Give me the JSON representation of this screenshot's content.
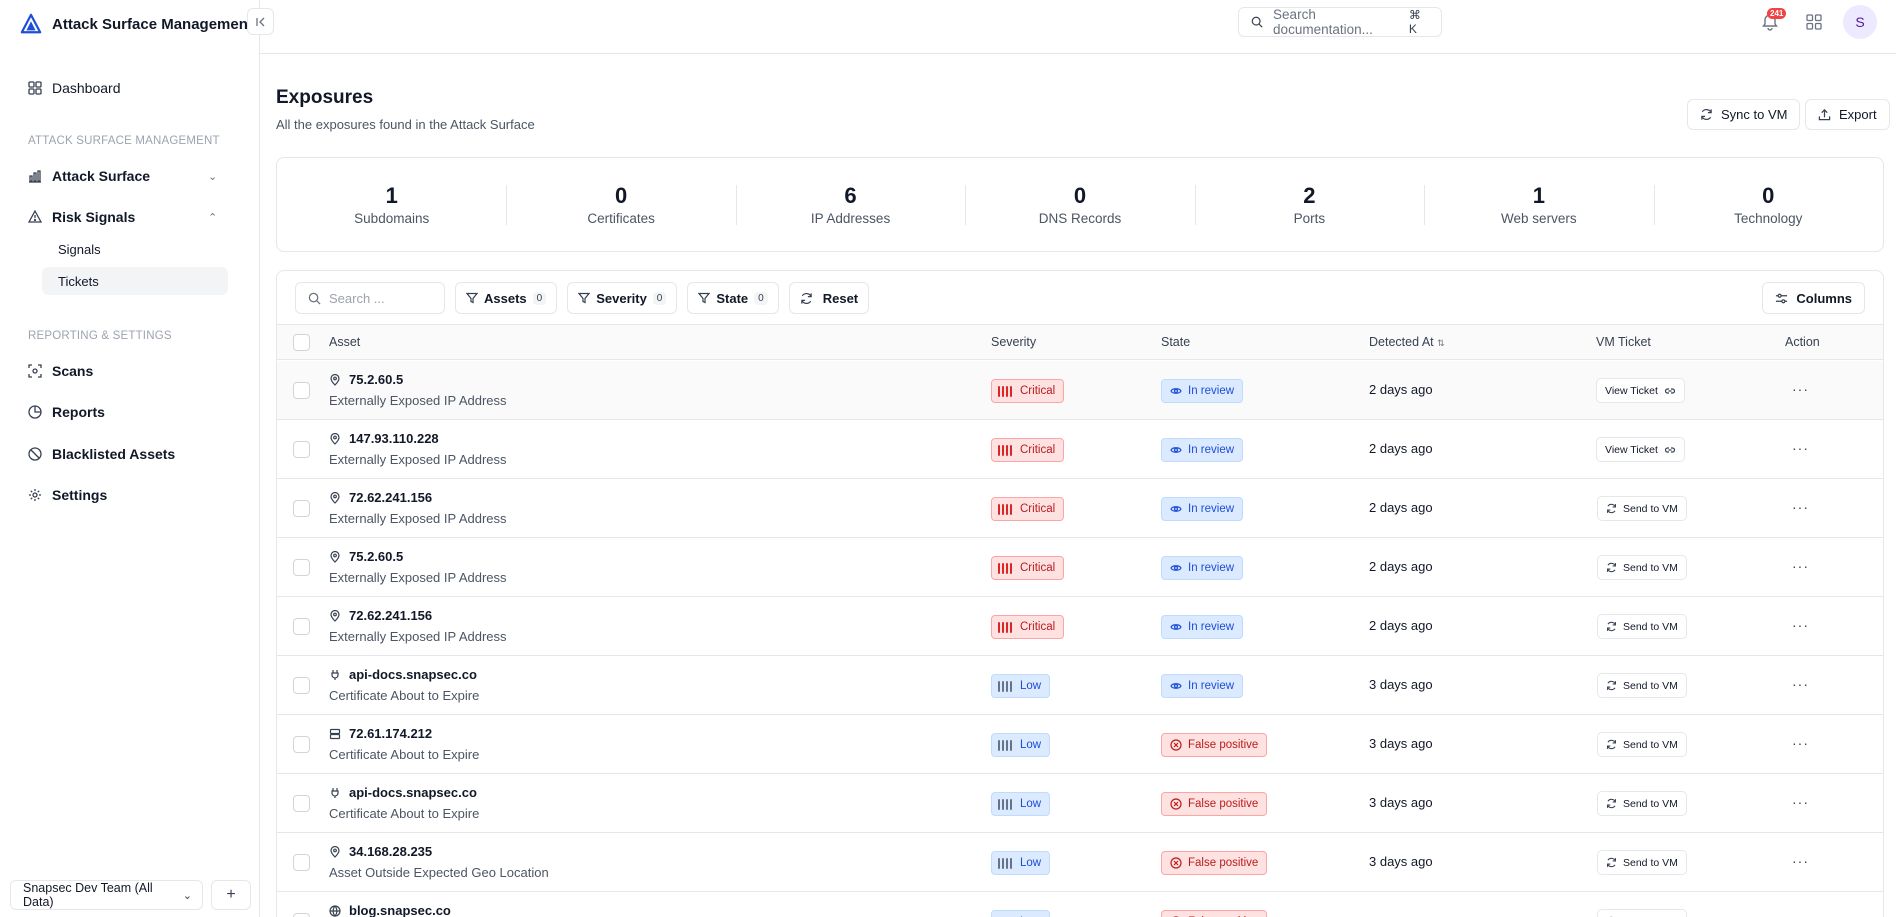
{
  "app": {
    "name": "Attack Surface Management"
  },
  "sidebar": {
    "dashboard": "Dashboard",
    "section_asm": "ATTACK SURFACE MANAGEMENT",
    "attack_surface": "Attack Surface",
    "risk_signals": "Risk Signals",
    "signals": "Signals",
    "tickets": "Tickets",
    "section_reporting": "REPORTING & SETTINGS",
    "scans": "Scans",
    "reports": "Reports",
    "blacklisted": "Blacklisted Assets",
    "settings": "Settings",
    "team": "Snapsec Dev Team (All Data)",
    "team_add": "+"
  },
  "topbar": {
    "search_placeholder": "Search documentation...",
    "search_kbd": "⌘ K",
    "notifications_count": "241",
    "avatar_initial": "S"
  },
  "header": {
    "title": "Exposures",
    "subtitle": "All the exposures found in the Attack Surface",
    "sync_label": "Sync to VM",
    "export_label": "Export"
  },
  "stats": [
    {
      "value": "1",
      "label": "Subdomains"
    },
    {
      "value": "0",
      "label": "Certificates"
    },
    {
      "value": "6",
      "label": "IP Addresses"
    },
    {
      "value": "0",
      "label": "DNS Records"
    },
    {
      "value": "2",
      "label": "Ports"
    },
    {
      "value": "1",
      "label": "Web servers"
    },
    {
      "value": "0",
      "label": "Technology"
    }
  ],
  "filters": {
    "search_placeholder": "Search ...",
    "assets": "Assets",
    "assets_count": "0",
    "severity": "Severity",
    "severity_count": "0",
    "state": "State",
    "state_count": "0",
    "reset": "Reset",
    "columns": "Columns"
  },
  "table": {
    "headers": {
      "asset": "Asset",
      "severity": "Severity",
      "state": "State",
      "detected": "Detected At",
      "vm_ticket": "VM Ticket",
      "action": "Action"
    },
    "rows": [
      {
        "name": "75.2.60.5",
        "icon": "location-icon",
        "desc": "Externally Exposed IP Address",
        "severity": "Critical",
        "state": "In review",
        "detected": "2 days ago",
        "vm": "View Ticket"
      },
      {
        "name": "147.93.110.228",
        "icon": "location-icon",
        "desc": "Externally Exposed IP Address",
        "severity": "Critical",
        "state": "In review",
        "detected": "2 days ago",
        "vm": "View Ticket"
      },
      {
        "name": "72.62.241.156",
        "icon": "location-icon",
        "desc": "Externally Exposed IP Address",
        "severity": "Critical",
        "state": "In review",
        "detected": "2 days ago",
        "vm": "Send to VM"
      },
      {
        "name": "75.2.60.5",
        "icon": "location-icon",
        "desc": "Externally Exposed IP Address",
        "severity": "Critical",
        "state": "In review",
        "detected": "2 days ago",
        "vm": "Send to VM"
      },
      {
        "name": "72.62.241.156",
        "icon": "location-icon",
        "desc": "Externally Exposed IP Address",
        "severity": "Critical",
        "state": "In review",
        "detected": "2 days ago",
        "vm": "Send to VM"
      },
      {
        "name": "api-docs.snapsec.co",
        "icon": "plug-icon",
        "desc": "Certificate About to Expire",
        "severity": "Low",
        "state": "In review",
        "detected": "3 days ago",
        "vm": "Send to VM"
      },
      {
        "name": "72.61.174.212",
        "icon": "server-icon",
        "desc": "Certificate About to Expire",
        "severity": "Low",
        "state": "False positive",
        "detected": "3 days ago",
        "vm": "Send to VM"
      },
      {
        "name": "api-docs.snapsec.co",
        "icon": "plug-icon",
        "desc": "Certificate About to Expire",
        "severity": "Low",
        "state": "False positive",
        "detected": "3 days ago",
        "vm": "Send to VM"
      },
      {
        "name": "34.168.28.235",
        "icon": "location-icon",
        "desc": "Asset Outside Expected Geo Location",
        "severity": "Low",
        "state": "False positive",
        "detected": "3 days ago",
        "vm": "Send to VM"
      },
      {
        "name": "blog.snapsec.co",
        "icon": "globe-icon",
        "desc": "",
        "severity": "Low",
        "state": "False positive",
        "detected": "",
        "vm": "Send to VM"
      }
    ]
  },
  "colors": {
    "accent": "#2563eb",
    "critical": "#dc2626",
    "low": "#1d4ed8"
  }
}
